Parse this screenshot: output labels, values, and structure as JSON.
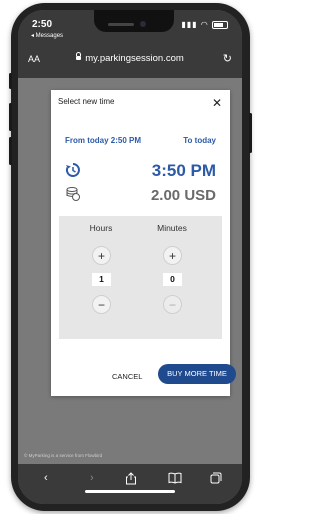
{
  "status_bar": {
    "time": "2:50",
    "back_app": "◂ Messages"
  },
  "browser": {
    "text_size_label": "AA",
    "url": "my.parkingsession.com"
  },
  "modal": {
    "title": "Select new time",
    "from_label": "From today 2:50 PM",
    "to_label": "To today",
    "new_time": "3:50 PM",
    "amount": "2.00 USD",
    "picker": {
      "hours_label": "Hours",
      "minutes_label": "Minutes",
      "hours_value": "1",
      "minutes_value": "0",
      "plus_glyph": "+",
      "minus_glyph": "−"
    },
    "cancel_label": "CANCEL",
    "buy_label": "BUY MORE TIME"
  },
  "footer_note": "© MyParking is a service from Flowbird",
  "icons": {
    "close": "close-icon",
    "clock": "clock-refresh-icon",
    "coins": "coins-icon",
    "reload": "reload-icon",
    "back": "back-icon",
    "forward": "forward-icon",
    "share": "share-icon",
    "bookmarks": "bookmarks-icon",
    "tabs": "tabs-icon"
  },
  "colors": {
    "accent": "#2c5aa8",
    "button": "#1f4a8e",
    "amount": "#6a6a6a"
  }
}
